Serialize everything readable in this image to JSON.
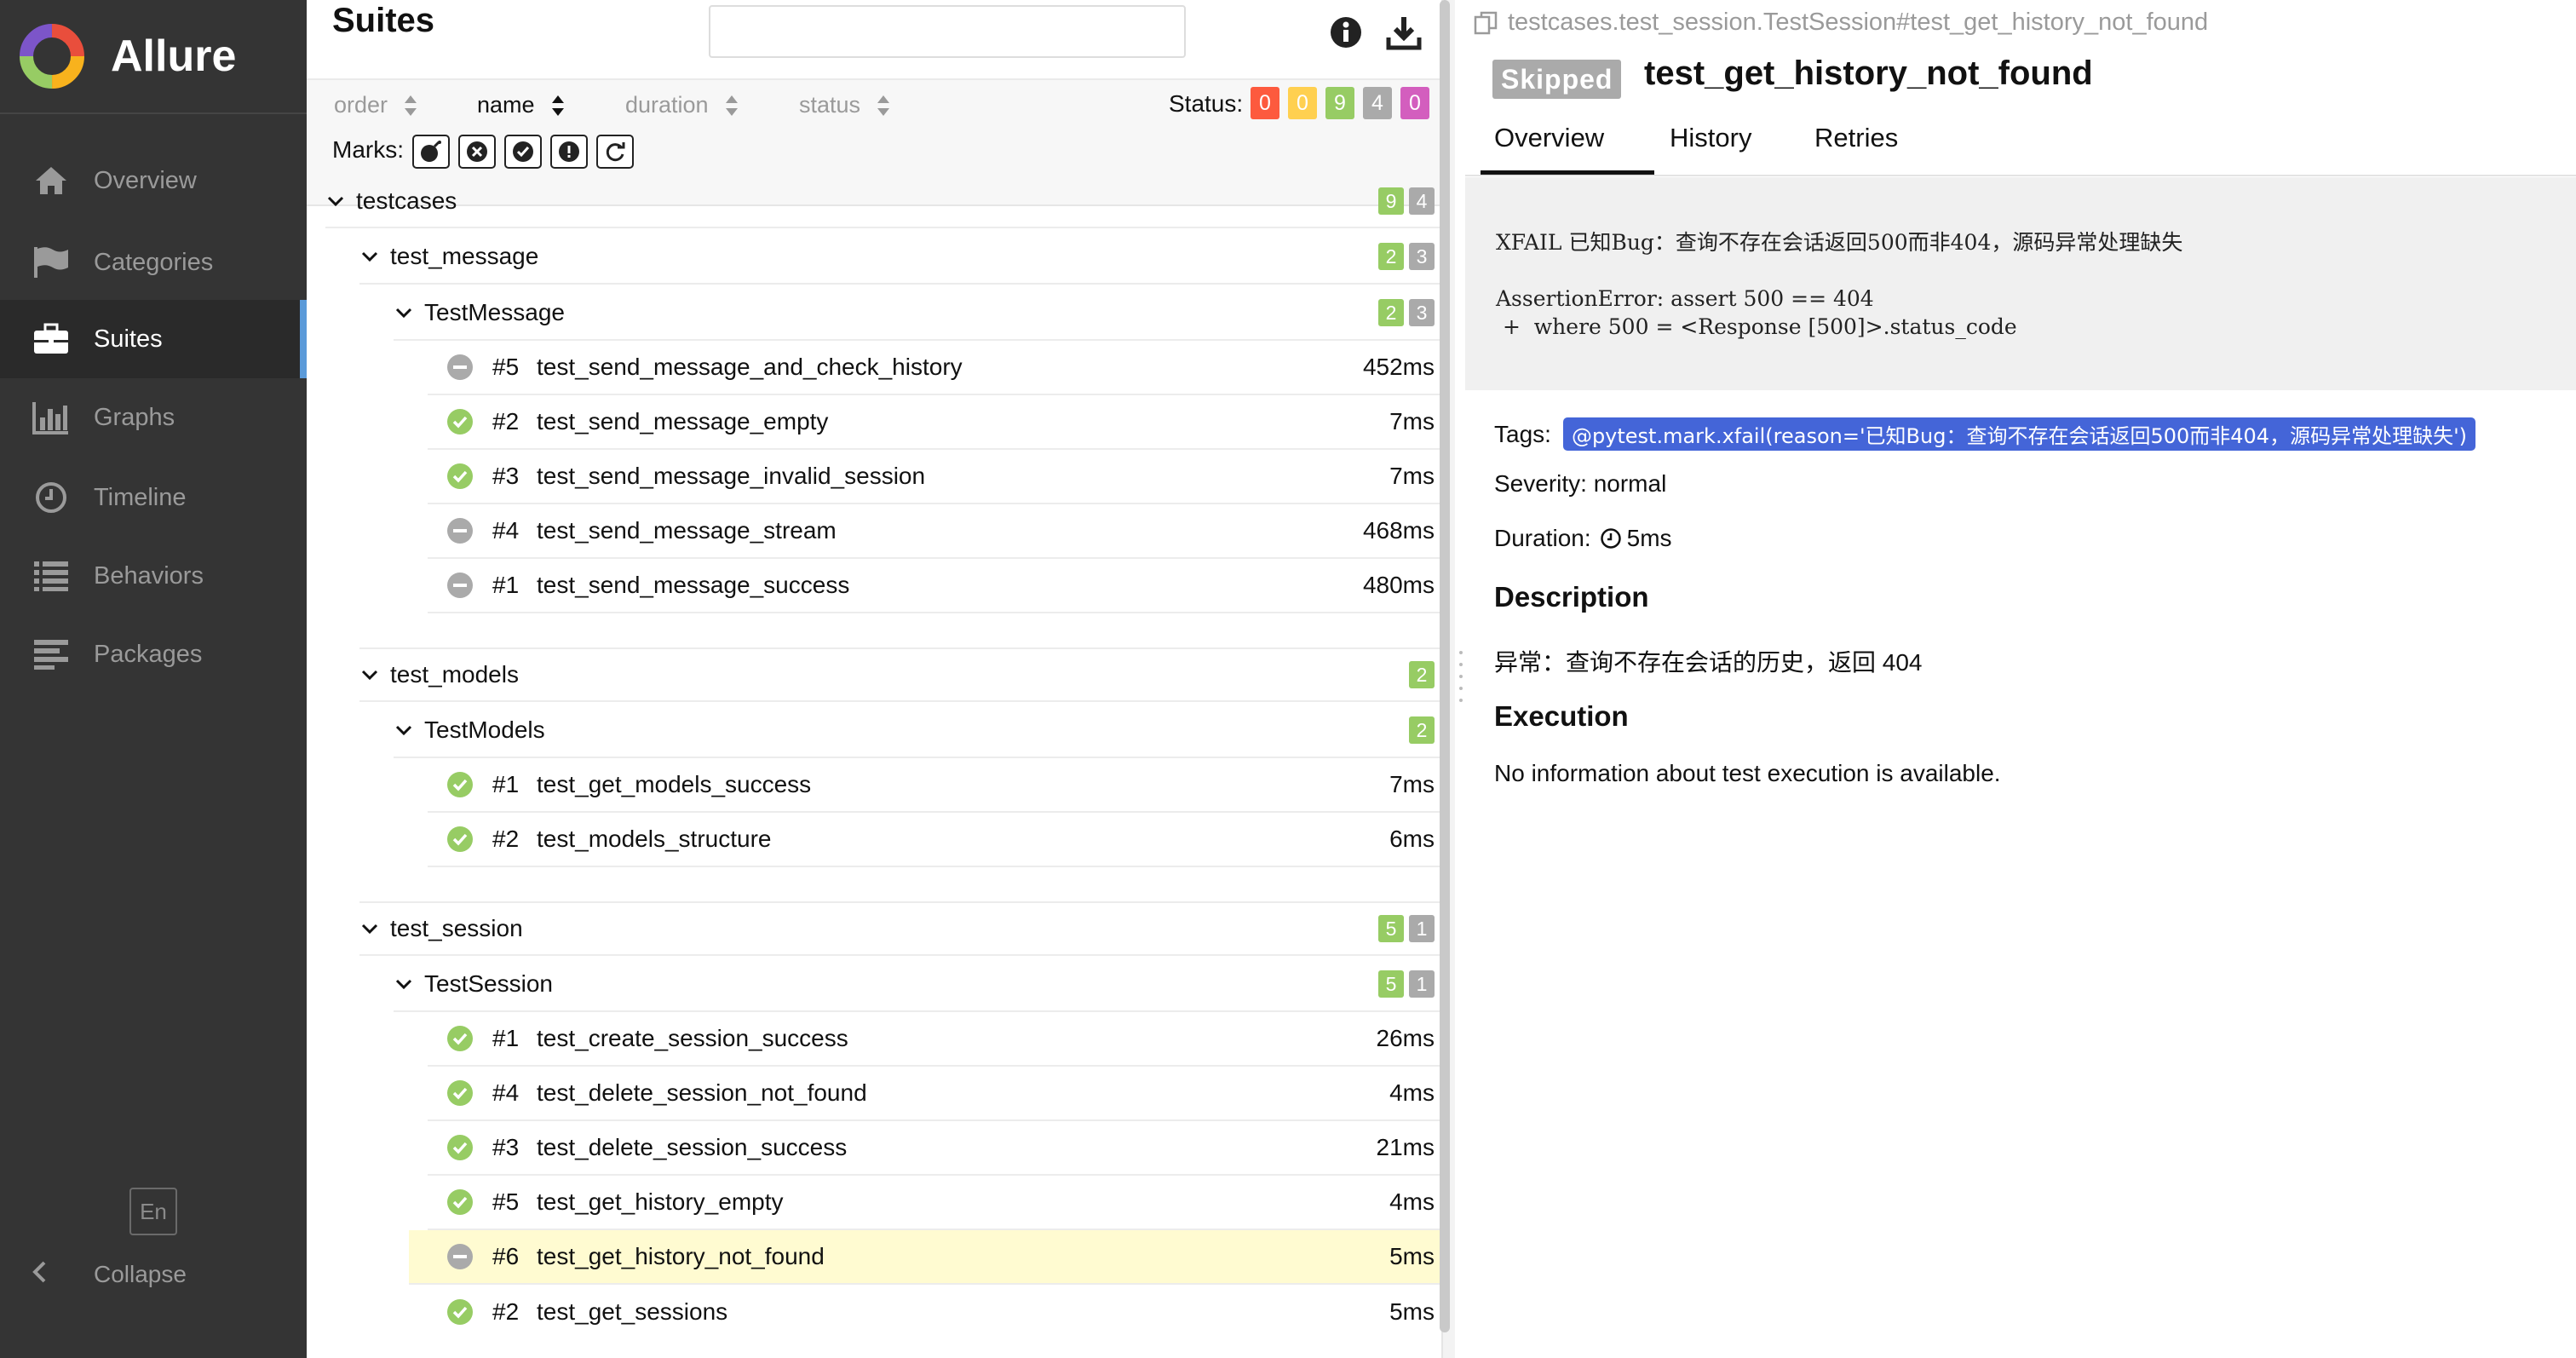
{
  "sidebar": {
    "brand": "Allure",
    "items": [
      {
        "label": "Overview",
        "icon": "home-icon"
      },
      {
        "label": "Categories",
        "icon": "flag-icon"
      },
      {
        "label": "Suites",
        "icon": "briefcase-icon",
        "active": true
      },
      {
        "label": "Graphs",
        "icon": "bar-chart-icon"
      },
      {
        "label": "Timeline",
        "icon": "clock-icon"
      },
      {
        "label": "Behaviors",
        "icon": "list-icon"
      },
      {
        "label": "Packages",
        "icon": "align-left-icon"
      }
    ],
    "lang": "En",
    "collapse": "Collapse"
  },
  "suites": {
    "title": "Suites",
    "search_value": "",
    "sort": {
      "order": "order",
      "name": "name",
      "duration": "duration",
      "status": "status"
    },
    "status_label": "Status:",
    "status_counts": [
      {
        "value": "0",
        "color": "#fd5a3e"
      },
      {
        "value": "0",
        "color": "#ffd050"
      },
      {
        "value": "9",
        "color": "#97cc64"
      },
      {
        "value": "4",
        "color": "#aaaaaa"
      },
      {
        "value": "0",
        "color": "#d35ebe"
      }
    ],
    "marks_label": "Marks:",
    "tree": {
      "root": {
        "name": "testcases",
        "passed": "9",
        "skipped": "4"
      },
      "groups": [
        {
          "module": "test_message",
          "passed": "2",
          "skipped": "3",
          "cls": "TestMessage",
          "tests": [
            {
              "order": "#5",
              "name": "test_send_message_and_check_history",
              "duration": "452ms",
              "status": "skipped"
            },
            {
              "order": "#2",
              "name": "test_send_message_empty",
              "duration": "7ms",
              "status": "passed"
            },
            {
              "order": "#3",
              "name": "test_send_message_invalid_session",
              "duration": "7ms",
              "status": "passed"
            },
            {
              "order": "#4",
              "name": "test_send_message_stream",
              "duration": "468ms",
              "status": "skipped"
            },
            {
              "order": "#1",
              "name": "test_send_message_success",
              "duration": "480ms",
              "status": "skipped"
            }
          ]
        },
        {
          "module": "test_models",
          "passed": "2",
          "skipped": "",
          "cls": "TestModels",
          "tests": [
            {
              "order": "#1",
              "name": "test_get_models_success",
              "duration": "7ms",
              "status": "passed"
            },
            {
              "order": "#2",
              "name": "test_models_structure",
              "duration": "6ms",
              "status": "passed"
            }
          ]
        },
        {
          "module": "test_session",
          "passed": "5",
          "skipped": "1",
          "cls": "TestSession",
          "tests": [
            {
              "order": "#1",
              "name": "test_create_session_success",
              "duration": "26ms",
              "status": "passed"
            },
            {
              "order": "#4",
              "name": "test_delete_session_not_found",
              "duration": "4ms",
              "status": "passed"
            },
            {
              "order": "#3",
              "name": "test_delete_session_success",
              "duration": "21ms",
              "status": "passed"
            },
            {
              "order": "#5",
              "name": "test_get_history_empty",
              "duration": "4ms",
              "status": "passed"
            },
            {
              "order": "#6",
              "name": "test_get_history_not_found",
              "duration": "5ms",
              "status": "skipped",
              "selected": true
            },
            {
              "order": "#2",
              "name": "test_get_sessions",
              "duration": "5ms",
              "status": "passed"
            }
          ]
        }
      ]
    }
  },
  "detail": {
    "breadcrumb": "testcases.test_session.TestSession#test_get_history_not_found",
    "status_badge": "Skipped",
    "title": "test_get_history_not_found",
    "tabs": [
      "Overview",
      "History",
      "Retries"
    ],
    "message": "XFAIL 已知Bug：查询不存在会话返回500而非404，源码异常处理缺失\n\nAssertionError: assert 500 == 404\n +  where 500 = <Response [500]>.status_code",
    "tags_label": "Tags:",
    "tag": "@pytest.mark.xfail(reason='已知Bug：查询不存在会话返回500而非404，源码异常处理缺失')",
    "severity": "Severity: normal",
    "duration_label": "Duration:",
    "duration": "5ms",
    "description_heading": "Description",
    "description": "异常：查询不存在会话的历史，返回 404",
    "execution_heading": "Execution",
    "execution_text": "No information about test execution is available."
  },
  "colors": {
    "passed": "#97cc64",
    "skipped": "#aaaaaa",
    "tag": "#4465d8",
    "selected_row": "#fffbd1"
  }
}
